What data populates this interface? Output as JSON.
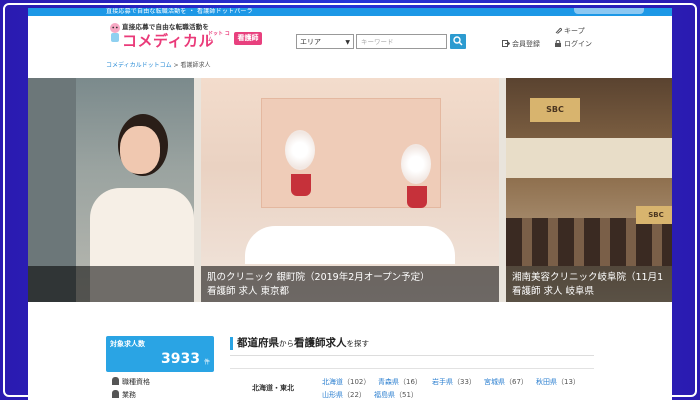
{
  "header": {
    "tagline": "直接応募で自由な転職活動を",
    "logo_text": "コメディカル",
    "logo_dotcom": "ドット コム",
    "badge": "看護師",
    "area_select": "エリア",
    "keyword_placeholder": "キーワード",
    "keep_label": "キープ",
    "register_label": "会員登録",
    "login_label": "ログイン"
  },
  "breadcrumb": {
    "home": "コメディカルドットコム",
    "separator": " > ",
    "current": "看護師求人"
  },
  "hero": {
    "slides": [
      {
        "line1": "",
        "line2": ""
      },
      {
        "line1": "肌のクリニック 銀町院（2019年2月オープン予定）",
        "line2": "看護師 求人 東京都"
      },
      {
        "line1": "湘南美容クリニック岐阜院（11月1",
        "line2": "看護師 求人 岐阜県",
        "sign": "SBC"
      }
    ]
  },
  "sidebar": {
    "count_label": "対象求人数",
    "count_value": "3933",
    "count_unit": "件",
    "link1": "職種資格",
    "link2": "業務"
  },
  "main": {
    "section_title_a": "都道府県",
    "section_title_b": "から",
    "section_title_c": "看護師求人",
    "section_title_d": "を探す",
    "region": "北海道・東北",
    "prefs": [
      {
        "name": "北海道",
        "count": "（102）"
      },
      {
        "name": "青森県",
        "count": "（16）"
      },
      {
        "name": "岩手県",
        "count": "（33）"
      },
      {
        "name": "宮城県",
        "count": "（67）"
      },
      {
        "name": "秋田県",
        "count": "（13）"
      },
      {
        "name": "山形県",
        "count": "（22）"
      },
      {
        "name": "福島県",
        "count": "（51）"
      }
    ]
  }
}
